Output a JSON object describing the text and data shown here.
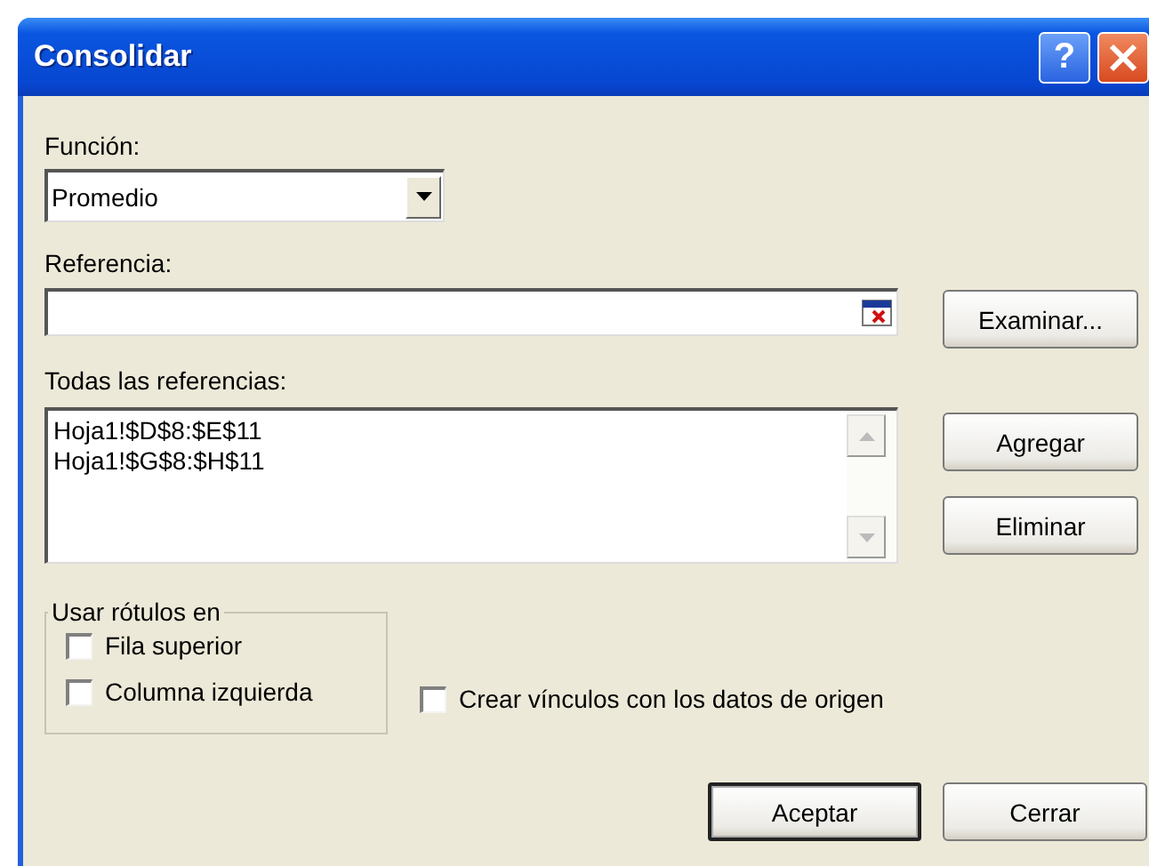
{
  "window": {
    "title": "Consolidar",
    "help_button": "?"
  },
  "function_field": {
    "label": "Función:",
    "value": "Promedio"
  },
  "reference_field": {
    "label": "Referencia:"
  },
  "browse_button": "Examinar...",
  "all_references": {
    "label": "Todas las referencias:",
    "items": [
      "Hoja1!$D$8:$E$11",
      "Hoja1!$G$8:$H$11"
    ]
  },
  "add_button": "Agregar",
  "delete_button": "Eliminar",
  "use_labels": {
    "title": "Usar rótulos en",
    "options": [
      {
        "label": "Fila superior",
        "checked": false
      },
      {
        "label": "Columna izquierda",
        "checked": false
      }
    ]
  },
  "link_option": {
    "label": "Crear vínculos con los datos de origen",
    "checked": false
  },
  "buttons": [
    {
      "label": "Aceptar",
      "default": true
    },
    {
      "label": "Cerrar",
      "default": false
    }
  ]
}
